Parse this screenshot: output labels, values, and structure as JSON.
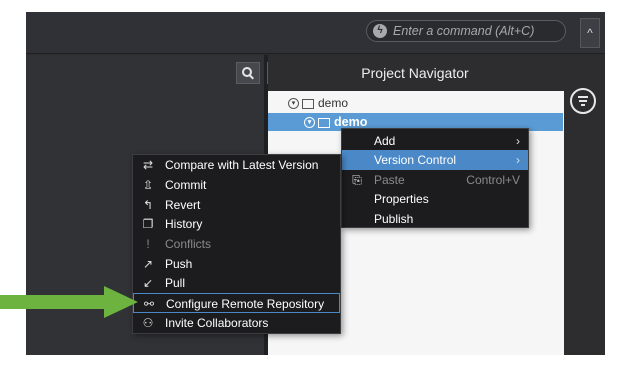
{
  "topbar": {
    "command_placeholder": "Enter a command (Alt+C)",
    "command_icon": "flash-icon",
    "up_icon": "chevron-up-icon"
  },
  "left_pane": {
    "search_icon": "search-icon",
    "tab_icon": "chevron-right-icon"
  },
  "navigator": {
    "title": "Project Navigator",
    "tree": [
      {
        "label": "demo",
        "type": "solution",
        "expanded": true
      },
      {
        "label": "demo",
        "type": "project",
        "expanded": true,
        "selected": true
      }
    ],
    "filter_icon": "filter-icon"
  },
  "context_menu": {
    "items": [
      {
        "label": "Add",
        "has_submenu": true,
        "icon": "none"
      },
      {
        "label": "Version Control",
        "has_submenu": true,
        "highlighted": true
      },
      {
        "label": "Paste",
        "shortcut": "Control+V",
        "disabled": true,
        "icon": "paste-icon"
      },
      {
        "label": "Properties"
      },
      {
        "label": "Publish"
      }
    ]
  },
  "version_control_menu": {
    "items": [
      {
        "label": "Compare with Latest Version",
        "icon": "compare-icon"
      },
      {
        "label": "Commit",
        "icon": "commit-icon"
      },
      {
        "label": "Revert",
        "icon": "revert-icon"
      },
      {
        "label": "History",
        "icon": "history-icon"
      },
      {
        "label": "Conflicts",
        "icon": "conflicts-icon",
        "disabled": true
      },
      {
        "label": "Push",
        "icon": "push-icon"
      },
      {
        "label": "Pull",
        "icon": "pull-icon"
      },
      {
        "label": "Configure Remote Repository",
        "icon": "remote-repo-icon",
        "highlighted": true
      },
      {
        "label": "Invite Collaborators",
        "icon": "collaborators-icon"
      }
    ]
  },
  "colors": {
    "selection": "#5b9bd5",
    "highlight": "#4a88c7",
    "annotation_arrow": "#6cb33f"
  }
}
